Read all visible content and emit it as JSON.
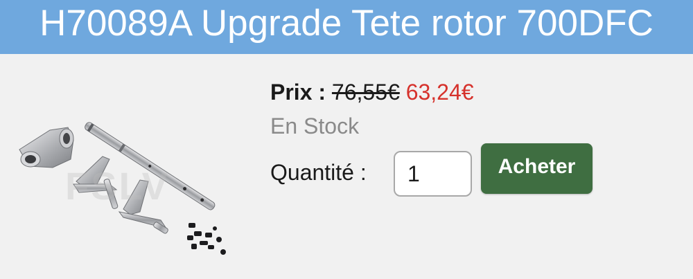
{
  "header": {
    "title": "H70089A Upgrade Tete rotor 700DFC"
  },
  "product": {
    "image_watermark": "FSLV",
    "price_label": "Prix :",
    "old_price": "76,55€",
    "new_price": "63,24€",
    "stock_status": "En Stock",
    "quantity_label": "Quantité :",
    "quantity_value": "1",
    "buy_button_label": "Acheter"
  },
  "colors": {
    "header_background": "#6fa8de",
    "sale_price": "#d6322c",
    "buy_button": "#3f6e41",
    "stock_text": "#8a8a8a"
  }
}
